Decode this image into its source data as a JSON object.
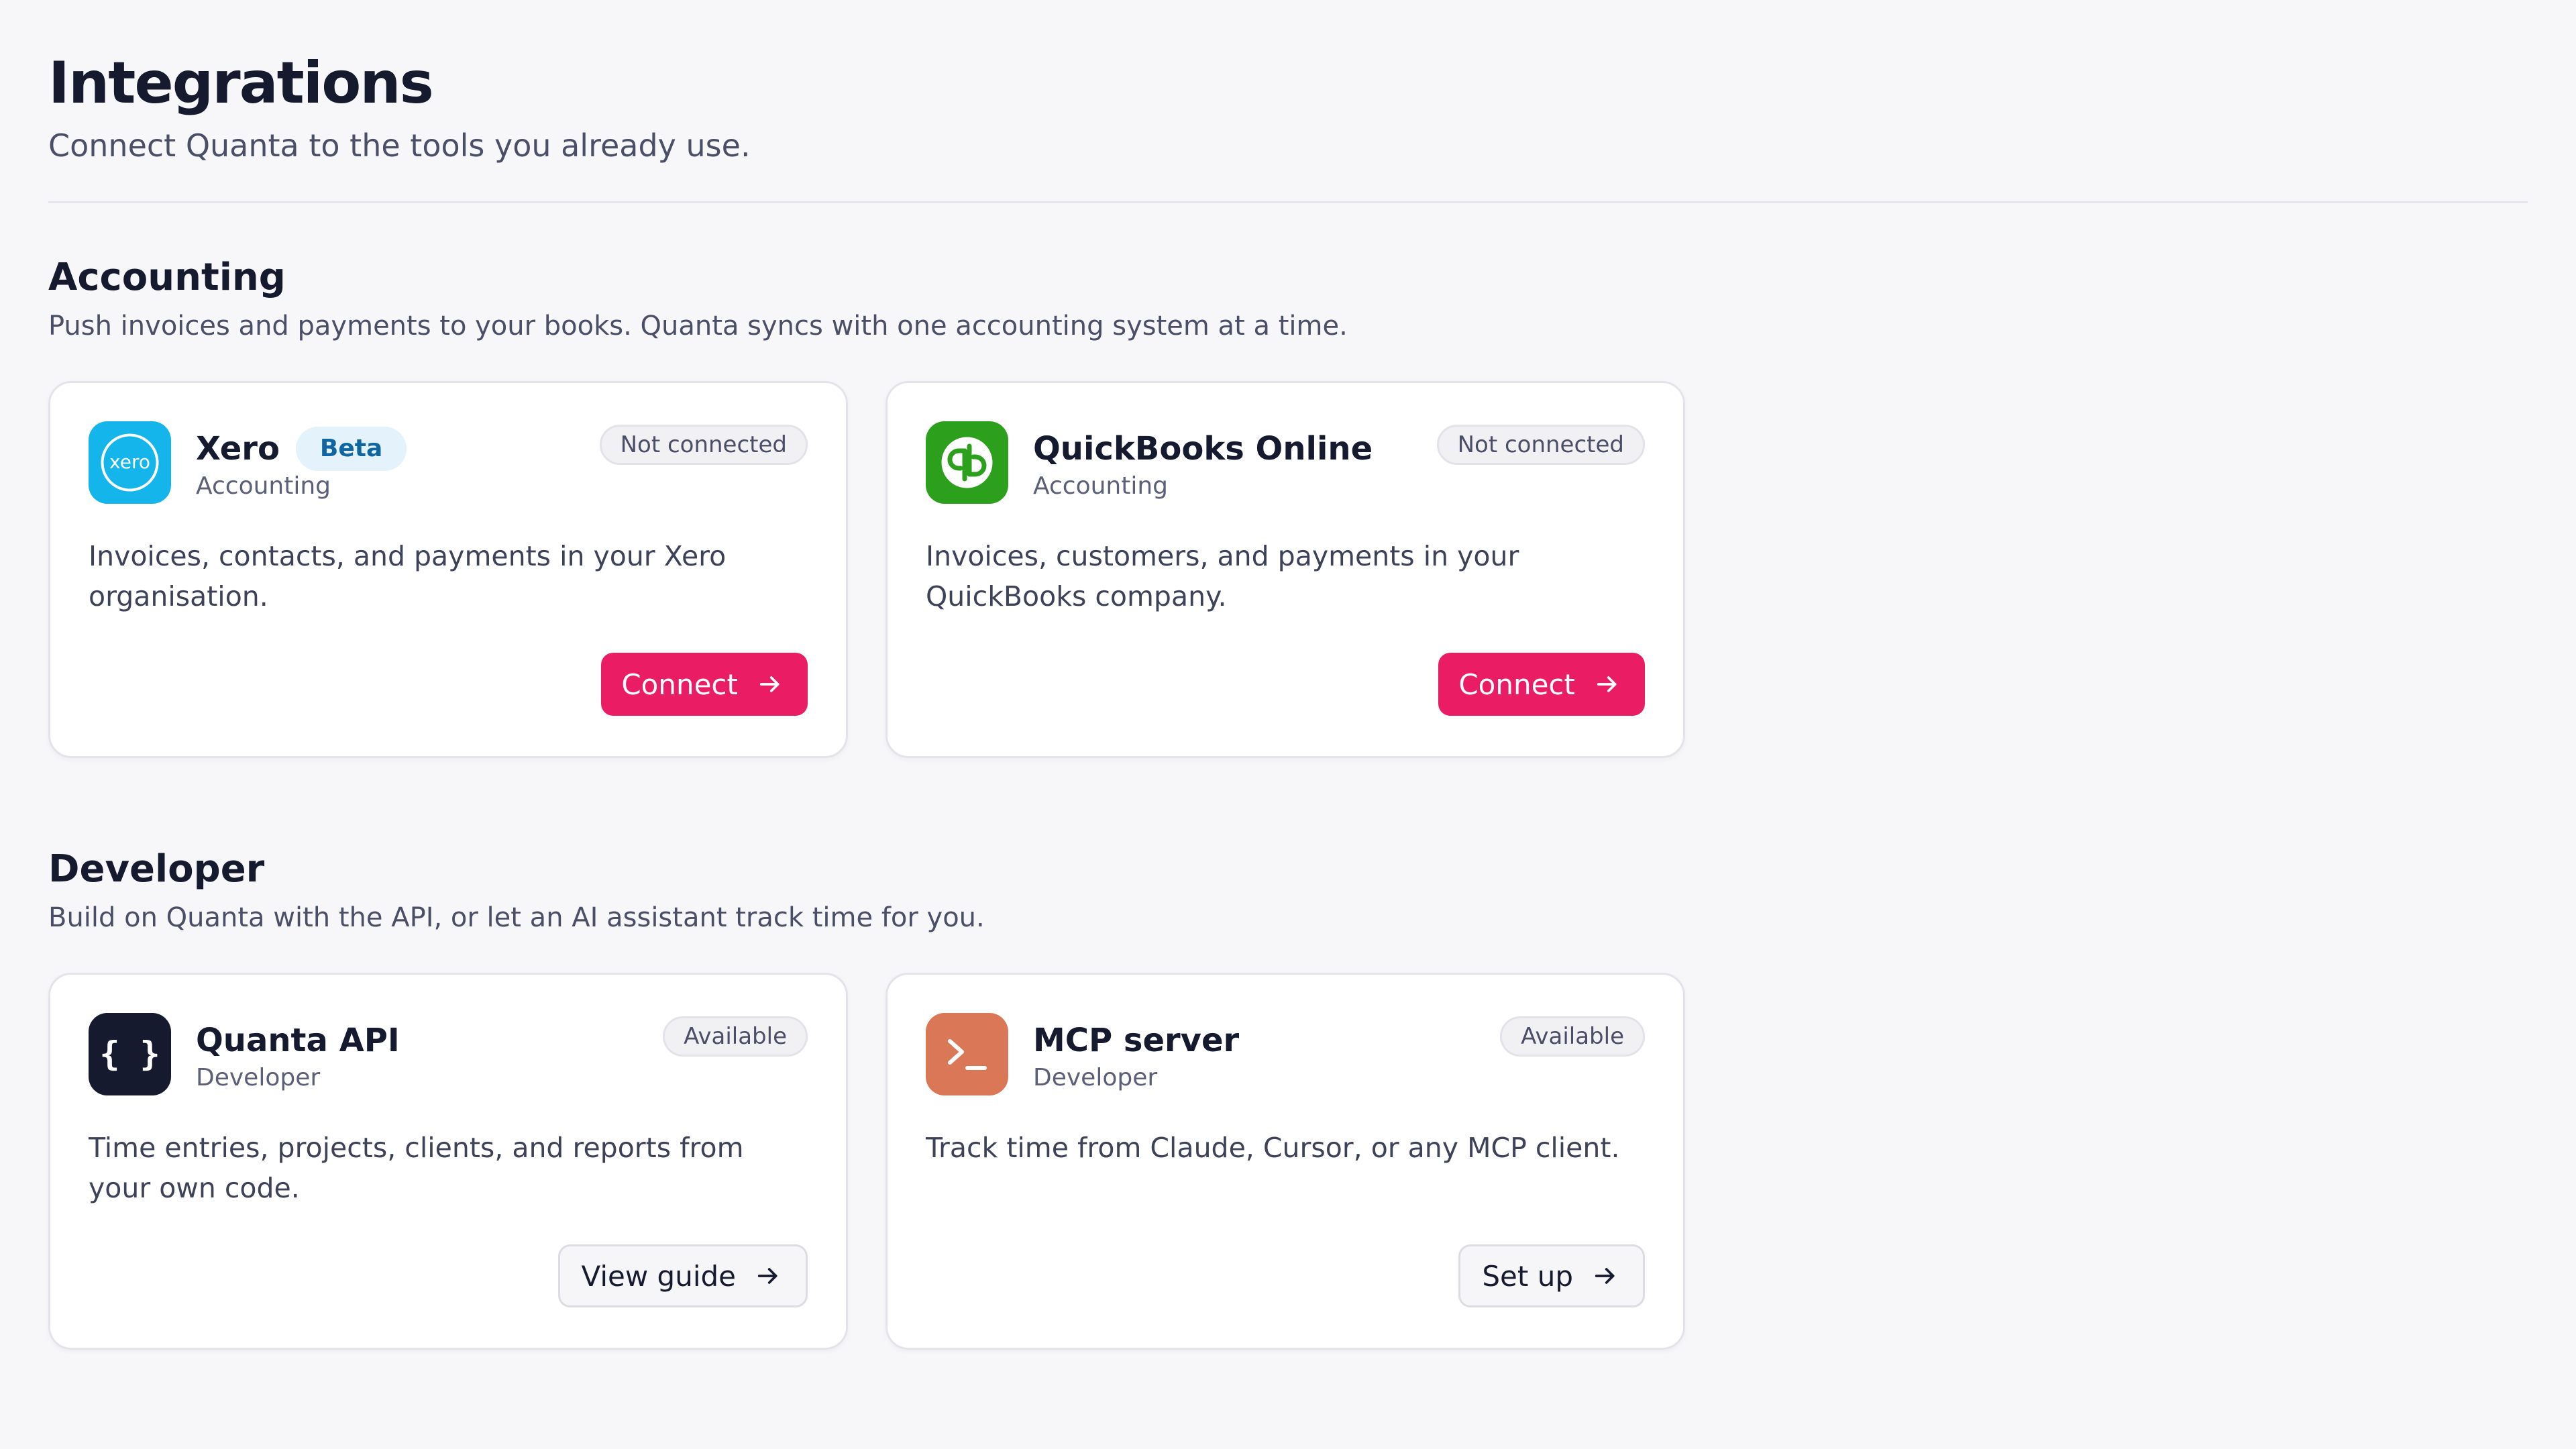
{
  "header": {
    "title": "Integrations",
    "subtitle": "Connect Quanta to the tools you already use."
  },
  "sections": [
    {
      "title": "Accounting",
      "description": "Push invoices and payments to your books. Quanta syncs with one accounting system at a time.",
      "cards": [
        {
          "name": "Xero",
          "badge": "Beta",
          "category": "Accounting",
          "status": "Not connected",
          "description": "Invoices, contacts, and payments in your Xero organisation.",
          "action": "Connect",
          "logo_text": "xero",
          "logo_color": "#13b5ea"
        },
        {
          "name": "QuickBooks Online",
          "category": "Accounting",
          "status": "Not connected",
          "description": "Invoices, customers, and payments in your QuickBooks company.",
          "action": "Connect",
          "logo_color": "#2ca01c"
        }
      ]
    },
    {
      "title": "Developer",
      "description": "Build on Quanta with the API, or let an AI assistant track time for you.",
      "cards": [
        {
          "name": "Quanta API",
          "category": "Developer",
          "status": "Available",
          "description": "Time entries, projects, clients, and reports from your own code.",
          "action": "View guide",
          "logo_text": "{ }",
          "logo_color": "#161a2e"
        },
        {
          "name": "MCP server",
          "category": "Developer",
          "status": "Available",
          "description": "Track time from Claude, Cursor, or any MCP client.",
          "action": "Set up",
          "logo_color": "#d97757"
        }
      ]
    }
  ],
  "colors": {
    "primary_button": "#ea1c63",
    "background": "#f7f7f9",
    "beta_badge_text": "#0f66a0"
  }
}
